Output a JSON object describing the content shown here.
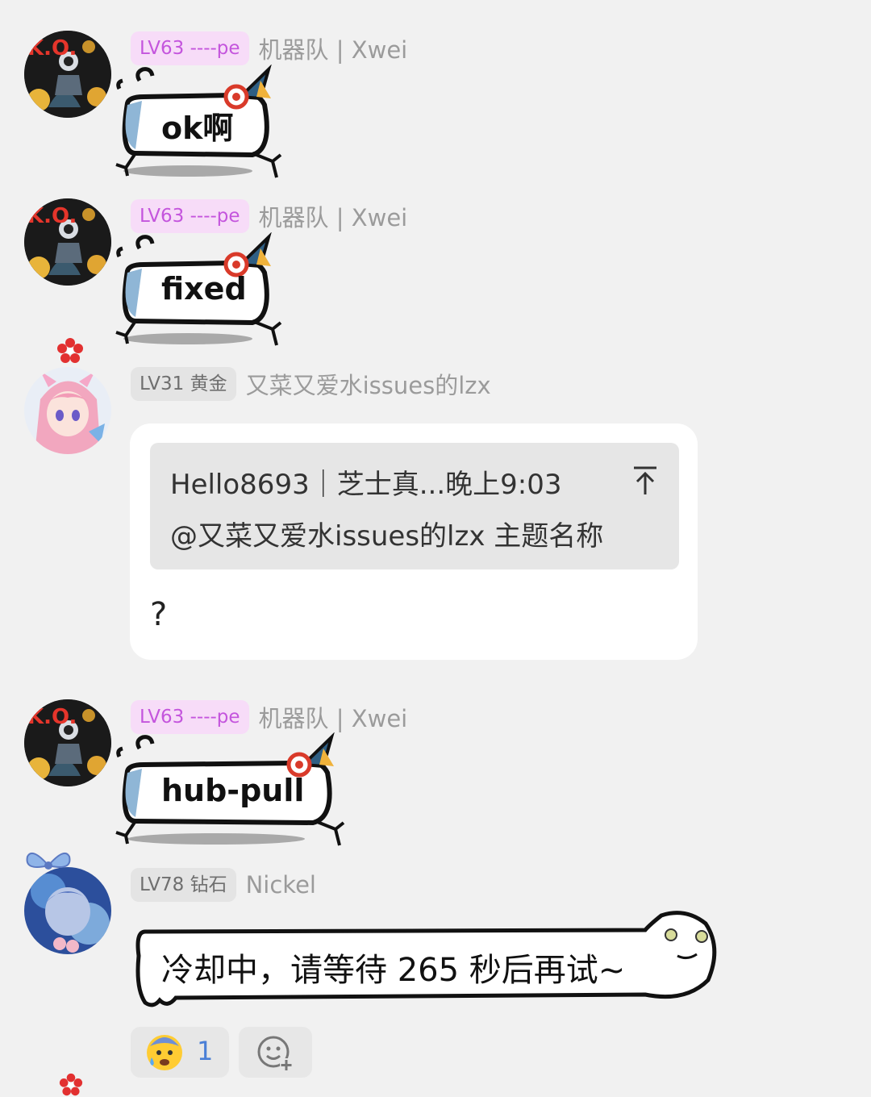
{
  "messages": [
    {
      "level": "LV63 ----pe",
      "name": "机器队 | Xwei",
      "sticker_text": "ok啊"
    },
    {
      "level": "LV63 ----pe",
      "name": "机器队 | Xwei",
      "sticker_text": "fixed"
    },
    {
      "level": "LV31 黄金",
      "name": "又菜又爱水issues的lzx",
      "quote_line1": "Hello8693｜芝士真...晚上9:03",
      "quote_line2": "@又菜又爱水issues的lzx 主题名称",
      "reply": "?"
    },
    {
      "level": "LV63 ----pe",
      "name": "机器队 | Xwei",
      "sticker_text": "hub-pull"
    },
    {
      "level": "LV78 钻石",
      "name": "Nickel",
      "text": "冷却中，请等待 265 秒后再试~"
    }
  ],
  "reactions": [
    {
      "emoji_name": "anxious-face-emoji",
      "count": "1"
    },
    {
      "emoji_name": "add-reaction-icon"
    }
  ],
  "colors": {
    "background": "#f1f1f1",
    "level_purple_bg": "#f7dcf8",
    "level_purple_text": "#c455dd",
    "level_gray_bg": "#e4e4e4",
    "username": "#9b9b9b",
    "reaction_count": "#4a7fd6"
  }
}
